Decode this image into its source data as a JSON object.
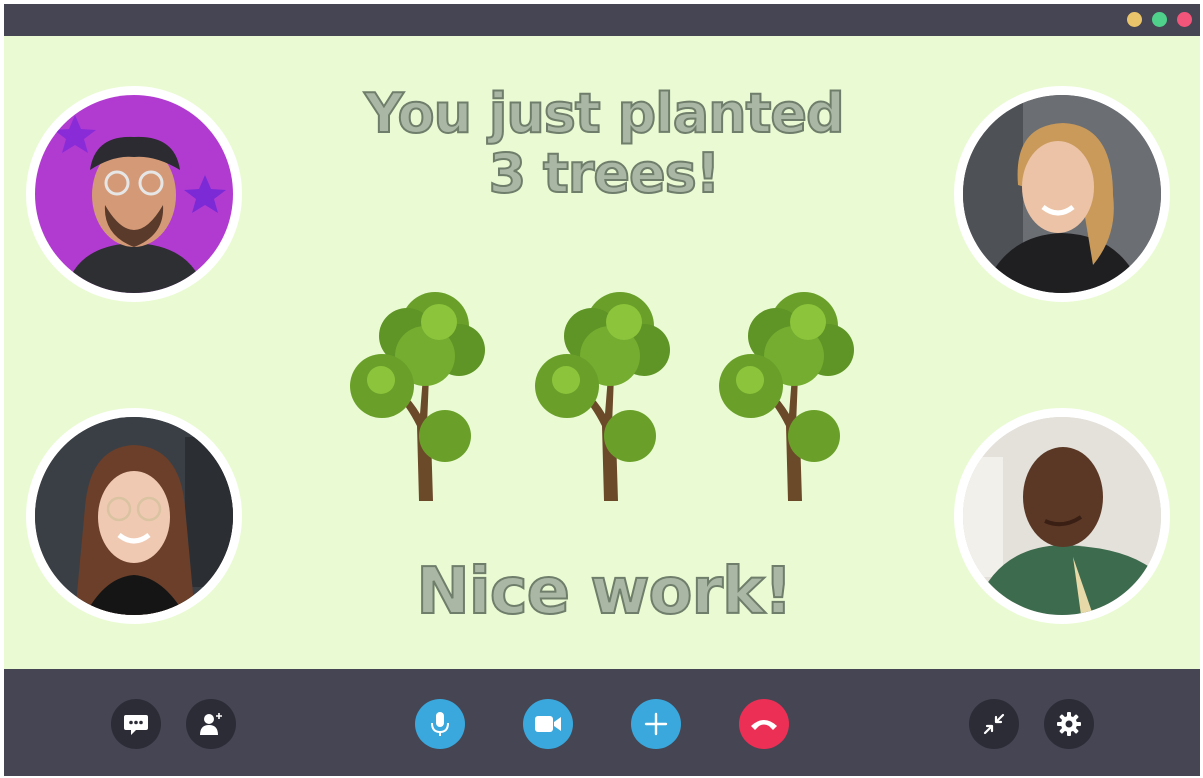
{
  "window": {
    "controls": [
      {
        "name": "minimize-dot",
        "color": "#e9c46a"
      },
      {
        "name": "maximize-dot",
        "color": "#4fd18b"
      },
      {
        "name": "close-dot",
        "color": "#f2557a"
      }
    ]
  },
  "stage": {
    "headline_line1": "You just planted",
    "headline_line2": "3 trees!",
    "footer": "Nice work!",
    "tree_count": 3,
    "tree_icon": "tree-icon"
  },
  "participants": [
    {
      "name": "participant-top-left",
      "bg": "#b13bd1"
    },
    {
      "name": "participant-top-right",
      "bg": "#5b5e63"
    },
    {
      "name": "participant-bottom-left",
      "bg": "#3a3f45"
    },
    {
      "name": "participant-bottom-right",
      "bg": "#d9d6cf"
    }
  ],
  "toolbar": {
    "left": [
      {
        "name": "chat-button",
        "icon": "chat-icon"
      },
      {
        "name": "add-participant-button",
        "icon": "add-person-icon"
      }
    ],
    "center": [
      {
        "name": "microphone-button",
        "icon": "microphone-icon",
        "color": "#3aa8dc"
      },
      {
        "name": "camera-button",
        "icon": "video-camera-icon",
        "color": "#3aa8dc"
      },
      {
        "name": "add-button",
        "icon": "plus-icon",
        "color": "#3aa8dc"
      },
      {
        "name": "end-call-button",
        "icon": "hang-up-icon",
        "color": "#ec2f55"
      }
    ],
    "right": [
      {
        "name": "minimize-view-button",
        "icon": "collapse-arrows-icon"
      },
      {
        "name": "settings-button",
        "icon": "gear-icon"
      }
    ]
  }
}
